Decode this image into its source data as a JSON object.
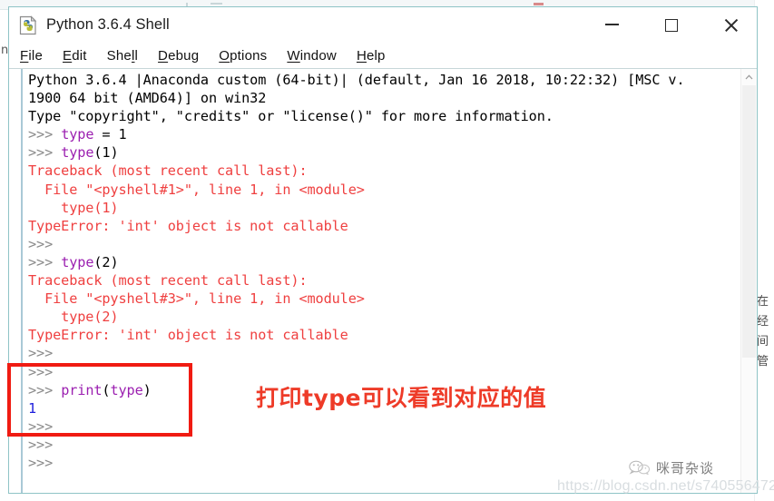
{
  "window": {
    "title": "Python 3.6.4 Shell",
    "icon": "python-idle-icon",
    "caption": {
      "minimize": "minimize",
      "maximize": "maximize",
      "close": "close"
    }
  },
  "menu": {
    "items": [
      {
        "label": "File",
        "accel": "F"
      },
      {
        "label": "Edit",
        "accel": "E"
      },
      {
        "label": "Shell",
        "accel": "l"
      },
      {
        "label": "Debug",
        "accel": "D"
      },
      {
        "label": "Options",
        "accel": "O"
      },
      {
        "label": "Window",
        "accel": "W"
      },
      {
        "label": "Help",
        "accel": "H"
      }
    ]
  },
  "shell": {
    "lines": [
      {
        "id": "banner-1",
        "text": "Python 3.6.4 |Anaconda custom (64-bit)| (default, Jan 16 2018, 10:22:32) [MSC v.",
        "class": "c-black"
      },
      {
        "id": "banner-2",
        "text": "1900 64 bit (AMD64)] on win32",
        "class": "c-black"
      },
      {
        "id": "banner-3",
        "text": "Type \"copyright\", \"credits\" or \"license()\" for more information.",
        "class": "c-black"
      },
      {
        "id": "stmt-1",
        "text": ">>> type = 1",
        "class": "c-prompt",
        "code": true
      },
      {
        "id": "stmt-2",
        "text": ">>> type(1)",
        "class": "c-prompt",
        "code": true
      },
      {
        "id": "tb1-head",
        "text": "Traceback (most recent call last):",
        "class": "c-err"
      },
      {
        "id": "tb1-file",
        "text": "  File \"<pyshell#1>\", line 1, in <module>",
        "class": "c-err"
      },
      {
        "id": "tb1-src",
        "text": "    type(1)",
        "class": "c-err"
      },
      {
        "id": "tb1-msg",
        "text": "TypeError: 'int' object is not callable",
        "class": "c-err"
      },
      {
        "id": "prompt-1",
        "text": ">>>",
        "class": "c-prompt"
      },
      {
        "id": "stmt-3",
        "text": ">>> type(2)",
        "class": "c-prompt",
        "code": true
      },
      {
        "id": "tb2-head",
        "text": "Traceback (most recent call last):",
        "class": "c-err"
      },
      {
        "id": "tb2-file",
        "text": "  File \"<pyshell#3>\", line 1, in <module>",
        "class": "c-err"
      },
      {
        "id": "tb2-src",
        "text": "    type(2)",
        "class": "c-err"
      },
      {
        "id": "tb2-msg",
        "text": "TypeError: 'int' object is not callable",
        "class": "c-err"
      },
      {
        "id": "prompt-2",
        "text": ">>>",
        "class": "c-prompt"
      },
      {
        "id": "prompt-3",
        "text": ">>>",
        "class": "c-prompt"
      },
      {
        "id": "stmt-4",
        "text": ">>> print(type)",
        "class": "c-prompt",
        "code": true
      },
      {
        "id": "output-1",
        "text": "1",
        "class": "c-out"
      },
      {
        "id": "prompt-4",
        "text": ">>>",
        "class": "c-prompt"
      },
      {
        "id": "prompt-5",
        "text": ">>>",
        "class": "c-prompt"
      },
      {
        "id": "prompt-6",
        "text": ">>>",
        "class": "c-prompt"
      }
    ],
    "segments": {
      "stmt-1": [
        {
          "t": ">>> ",
          "c": "c-prompt"
        },
        {
          "t": "type",
          "c": "c-kw"
        },
        {
          "t": " = 1",
          "c": "c-black"
        }
      ],
      "stmt-2": [
        {
          "t": ">>> ",
          "c": "c-prompt"
        },
        {
          "t": "type",
          "c": "c-kw"
        },
        {
          "t": "(1)",
          "c": "c-black"
        }
      ],
      "stmt-3": [
        {
          "t": ">>> ",
          "c": "c-prompt"
        },
        {
          "t": "type",
          "c": "c-kw"
        },
        {
          "t": "(2)",
          "c": "c-black"
        }
      ],
      "stmt-4": [
        {
          "t": ">>> ",
          "c": "c-prompt"
        },
        {
          "t": "print",
          "c": "c-kw"
        },
        {
          "t": "(",
          "c": "c-black"
        },
        {
          "t": "type",
          "c": "c-kw"
        },
        {
          "t": ")",
          "c": "c-black"
        }
      ]
    }
  },
  "annotation": {
    "note": "打印type可以看到对应的值",
    "box_color": "#f01b12",
    "text_color": "#ee3b28"
  },
  "scrollbar": {
    "up_arrow": "▲"
  },
  "watermark": {
    "brand": "咪哥杂谈",
    "url": "https://blog.csdn.net/s740556472"
  },
  "side_text": {
    "vertical": "在\n经\n间\n管"
  }
}
